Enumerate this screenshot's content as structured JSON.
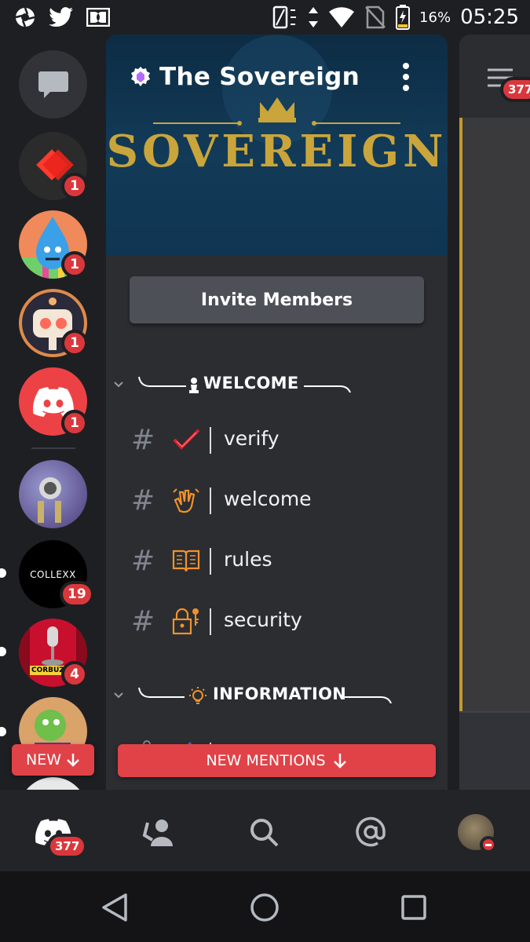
{
  "status_bar": {
    "battery_percent": "16%",
    "time": "05:25"
  },
  "server_rail": {
    "dm_button": "direct-messages",
    "servers": [
      {
        "name": "server-red",
        "badge": "1",
        "color": "#2b2b2b"
      },
      {
        "name": "server-water-drop",
        "badge": "1",
        "color": "#f08a5a"
      },
      {
        "name": "server-robot",
        "badge": "1",
        "color": "#f3b06d"
      },
      {
        "name": "server-discord",
        "badge": "1",
        "color": "#ed4245"
      },
      {
        "name": "server-purple",
        "badge": "",
        "color": "#6b6aa8"
      },
      {
        "name": "server-collexx",
        "badge": "19",
        "label": "COLLEXX",
        "color": "#000000"
      },
      {
        "name": "server-corbuzier",
        "badge": "4",
        "label": "CORBUZIER",
        "color": "#c8102e"
      },
      {
        "name": "server-green",
        "badge": "",
        "color": "#4a3b7a"
      }
    ],
    "new_label": "NEW"
  },
  "channel_panel": {
    "server_name": "The Sovereign",
    "banner_logo": "SOVEREIGN",
    "invite_label": "Invite Members",
    "categories": [
      {
        "label": "WELCOME"
      },
      {
        "label": "INFORMATION"
      }
    ],
    "channels": [
      {
        "name": "verify",
        "emoji": "check-mark-icon"
      },
      {
        "name": "welcome",
        "emoji": "waving-hands-icon"
      },
      {
        "name": "rules",
        "emoji": "book-icon"
      },
      {
        "name": "security",
        "emoji": "lock-key-icon"
      }
    ],
    "new_mentions_label": "NEW MENTIONS"
  },
  "peek": {
    "badge": "377"
  },
  "tab_bar": {
    "home_badge": "377"
  },
  "colors": {
    "accent_red": "#e04248",
    "panel": "#2b2d31",
    "rail": "#1e1f22",
    "gold": "#c9a53b"
  }
}
